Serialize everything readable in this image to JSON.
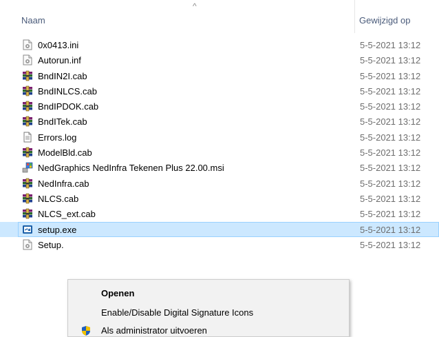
{
  "header": {
    "name_label": "Naam",
    "date_label": "Gewijzigd op",
    "sort_glyph": "^"
  },
  "files": [
    {
      "name": "0x0413.ini",
      "date": "5-5-2021 13:12",
      "icon": "ini-settings-icon"
    },
    {
      "name": "Autorun.inf",
      "date": "5-5-2021 13:12",
      "icon": "inf-settings-icon"
    },
    {
      "name": "BndIN2I.cab",
      "date": "5-5-2021 13:12",
      "icon": "cab-archive-icon"
    },
    {
      "name": "BndINLCS.cab",
      "date": "5-5-2021 13:12",
      "icon": "cab-archive-icon"
    },
    {
      "name": "BndIPDOK.cab",
      "date": "5-5-2021 13:12",
      "icon": "cab-archive-icon"
    },
    {
      "name": "BndITek.cab",
      "date": "5-5-2021 13:12",
      "icon": "cab-archive-icon"
    },
    {
      "name": "Errors.log",
      "date": "5-5-2021 13:12",
      "icon": "text-document-icon"
    },
    {
      "name": "ModelBld.cab",
      "date": "5-5-2021 13:12",
      "icon": "cab-archive-icon"
    },
    {
      "name": "NedGraphics NedInfra Tekenen Plus 22.00.msi",
      "date": "5-5-2021 13:12",
      "icon": "msi-installer-icon"
    },
    {
      "name": "NedInfra.cab",
      "date": "5-5-2021 13:12",
      "icon": "cab-archive-icon"
    },
    {
      "name": "NLCS.cab",
      "date": "5-5-2021 13:12",
      "icon": "cab-archive-icon"
    },
    {
      "name": "NLCS_ext.cab",
      "date": "5-5-2021 13:12",
      "icon": "cab-archive-icon"
    },
    {
      "name": "setup.exe",
      "date": "5-5-2021 13:12",
      "icon": "setup-exe-icon",
      "selected": true
    },
    {
      "name": "Setup.",
      "date": "5-5-2021 13:12",
      "icon": "ini-settings-icon"
    }
  ],
  "context_menu": {
    "items": [
      {
        "label": "Openen",
        "bold": true
      },
      {
        "label": "Enable/Disable Digital Signature Icons"
      },
      {
        "label": "Als administrator uitvoeren",
        "icon": "uac-shield-icon"
      }
    ]
  },
  "colors": {
    "selection_bg": "#cce8ff",
    "selection_border": "#99d1ff",
    "header_text": "#4a5b7a",
    "date_text": "#6d6d6d"
  }
}
